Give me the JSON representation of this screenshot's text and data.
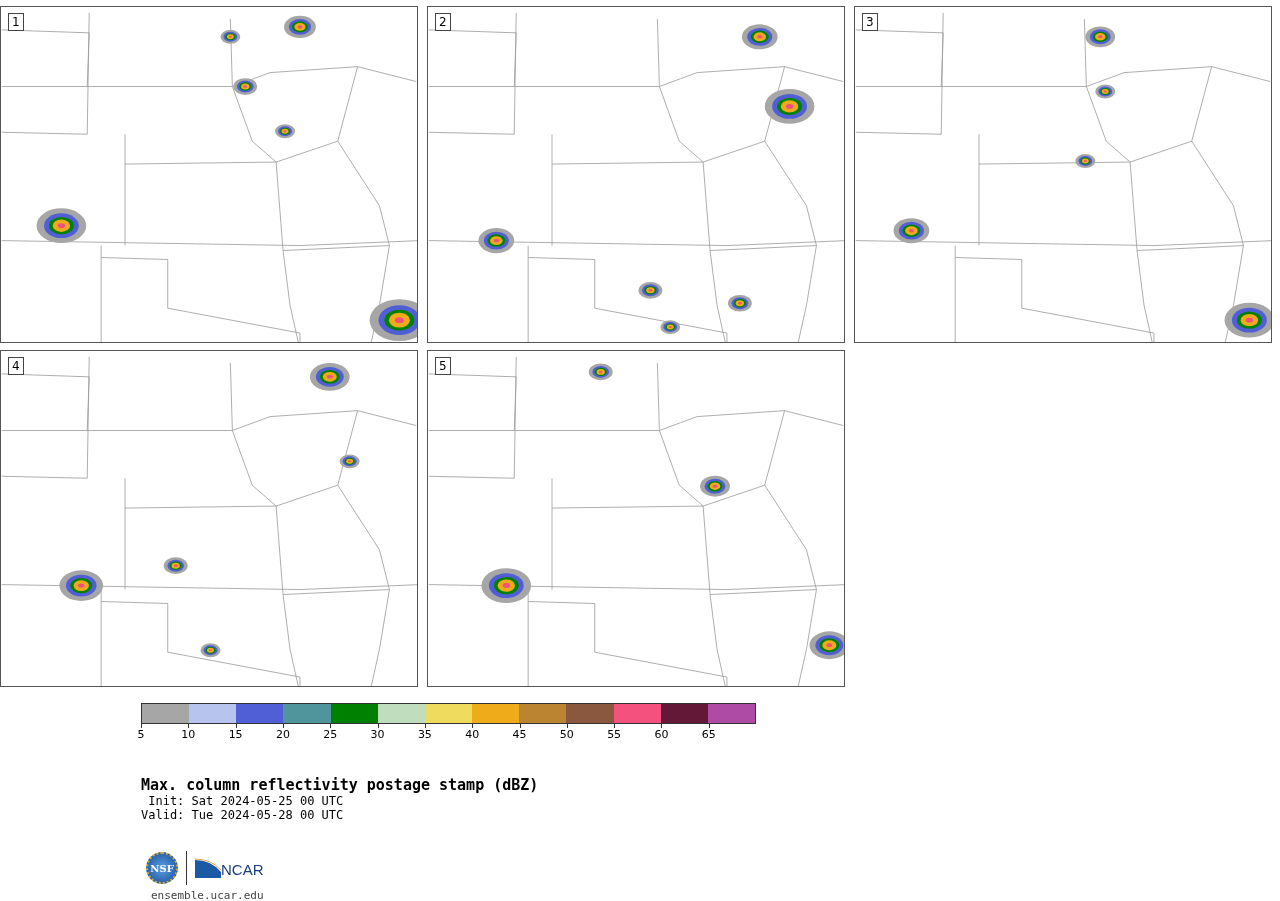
{
  "panels": [
    {
      "label": "1"
    },
    {
      "label": "2"
    },
    {
      "label": "3"
    },
    {
      "label": "4"
    },
    {
      "label": "5"
    }
  ],
  "colorbar": {
    "bins": [
      {
        "color": "#a6a6a6"
      },
      {
        "color": "#b7c4ee"
      },
      {
        "color": "#505fd6"
      },
      {
        "color": "#4f959b"
      },
      {
        "color": "#008000"
      },
      {
        "color": "#c0ddbd"
      },
      {
        "color": "#efdb5e"
      },
      {
        "color": "#f0ab1a"
      },
      {
        "color": "#bb8431"
      },
      {
        "color": "#8a583e"
      },
      {
        "color": "#f4517f"
      },
      {
        "color": "#621836"
      },
      {
        "color": "#ae4ca5"
      }
    ],
    "ticks": [
      "5",
      "10",
      "15",
      "20",
      "25",
      "30",
      "35",
      "40",
      "45",
      "50",
      "55",
      "60",
      "65"
    ]
  },
  "title": "Max. column reflectivity postage stamp (dBZ)",
  "init": " Init: Sat 2024-05-25 00 UTC",
  "valid": "Valid: Tue 2024-05-28 00 UTC",
  "logos": {
    "nsf": "NSF",
    "ncar": "NCAR"
  },
  "footer": "ensemble.ucar.edu"
}
